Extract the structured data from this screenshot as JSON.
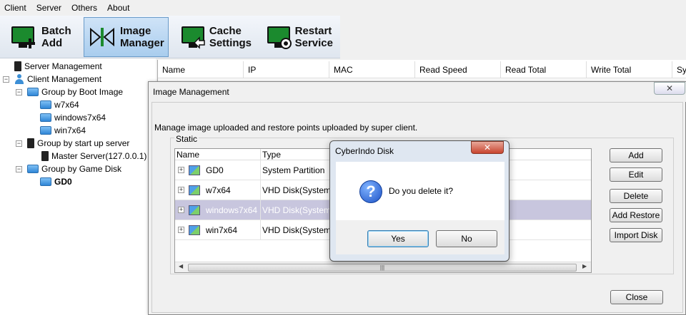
{
  "menu": [
    "Client",
    "Server",
    "Others",
    "About"
  ],
  "toolbar": {
    "batch_add": [
      "Batch",
      "Add"
    ],
    "image_manager": [
      "Image",
      "Manager"
    ],
    "cache_settings": [
      "Cache",
      "Settings"
    ],
    "restart_service": [
      "Restart",
      "Service"
    ]
  },
  "tree": {
    "server_management": "Server Management",
    "client_management": "Client Management",
    "group_boot_image": "Group by Boot Image",
    "w7x64": "w7x64",
    "windows7x64": "windows7x64",
    "win7x64": "win7x64",
    "group_startup_server": "Group by start up server",
    "master_server": "Master Server(127.0.0.1)",
    "group_game_disk": "Group by Game Disk",
    "gd0": "GD0"
  },
  "grid": {
    "columns": [
      "Name",
      "IP",
      "MAC",
      "Read Speed",
      "Read Total",
      "Write Total",
      "Sys"
    ]
  },
  "image_dialog": {
    "title": "Image Management",
    "description": "Manage image uploaded and restore points uploaded by super client.",
    "group_label": "Static",
    "columns": [
      "Name",
      "Type"
    ],
    "rows": [
      {
        "name": "GD0",
        "type": "System Partition"
      },
      {
        "name": "w7x64",
        "type": "VHD Disk(System Im"
      },
      {
        "name": "windows7x64",
        "type": "VHD Disk(System Im"
      },
      {
        "name": "win7x64",
        "type": "VHD Disk(System Im"
      }
    ],
    "buttons": {
      "add": "Add",
      "edit": "Edit",
      "delete": "Delete",
      "add_restore": "Add Restore",
      "import_disk": "Import Disk",
      "close": "Close"
    }
  },
  "confirm_dialog": {
    "title": "CyberIndo Disk",
    "message": "Do you delete it?",
    "yes": "Yes",
    "no": "No"
  }
}
